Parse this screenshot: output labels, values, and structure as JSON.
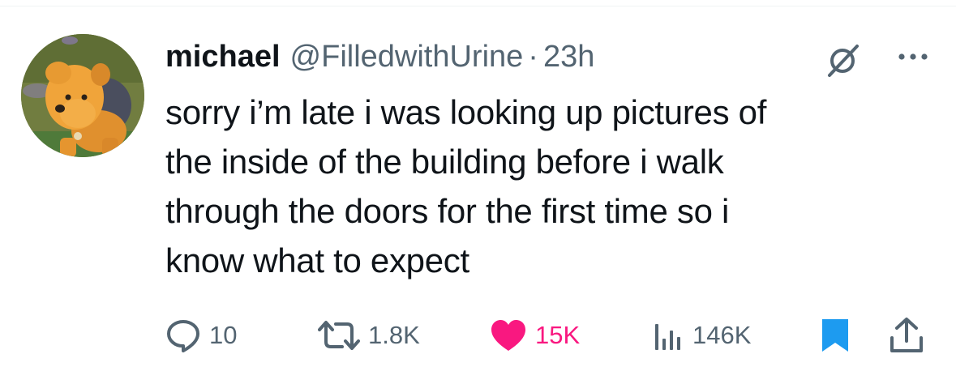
{
  "user": {
    "display_name": "michael",
    "handle": "@FilledwithUrine",
    "separator": "·",
    "timestamp": "23h"
  },
  "tweet": {
    "text_lines": [
      "sorry i’m late i was looking up pictures of",
      "the inside of the building before i walk",
      "through the doors for the first time so i",
      "know what to expect"
    ]
  },
  "actions": {
    "replies": "10",
    "reposts": "1.8K",
    "likes": "15K",
    "views": "146K",
    "bookmarked": true
  },
  "icons": {
    "avatar": "avatar-stuffed-dog",
    "grok": "grok-icon",
    "more": "more-icon",
    "reply": "reply-icon",
    "repost": "repost-icon",
    "like": "heart-icon",
    "views": "views-icon",
    "bookmark": "bookmark-icon",
    "share": "share-icon"
  },
  "colors": {
    "text": "#0f1419",
    "secondary": "#536471",
    "like": "#f91880",
    "bookmark": "#1d9bf0"
  }
}
